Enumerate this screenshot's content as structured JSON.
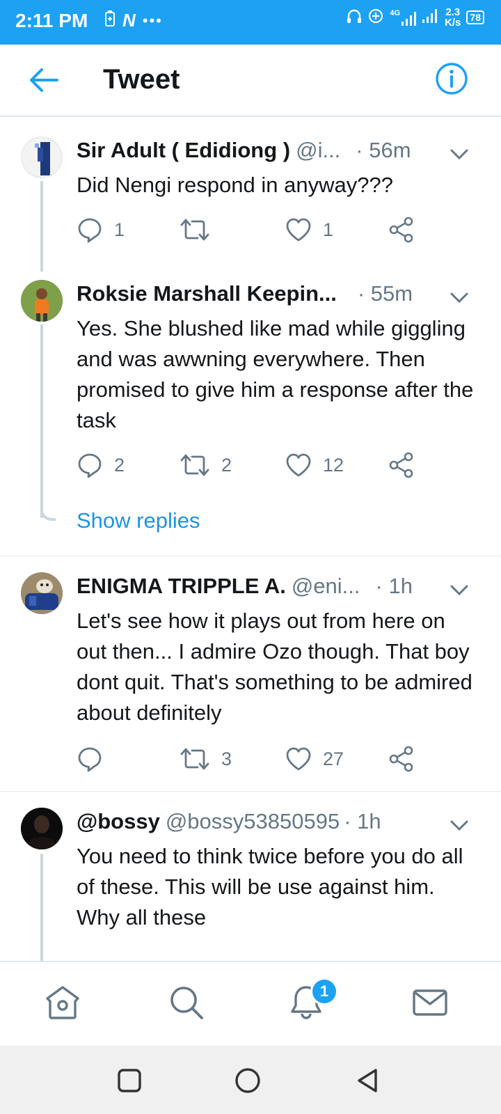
{
  "status_bar": {
    "time": "2:11 PM",
    "left_glyph": "N",
    "more_dots": "•••",
    "network_label": "4G",
    "speed_value": "2.3",
    "speed_unit": "K/s",
    "battery": "78",
    "bg_color": "#1da1f2"
  },
  "header": {
    "title": "Tweet",
    "back_icon": "arrow-left-icon",
    "info_icon": "info-icon"
  },
  "tweets": [
    {
      "name": "Sir Adult ( Edidiong )",
      "handle": "@i...",
      "time": "· 56m",
      "text": "Did Nengi respond in anyway???",
      "replies": "1",
      "retweets": "",
      "likes": "1"
    },
    {
      "name": "Roksie Marshall Keepin...",
      "handle": "",
      "time": "· 55m",
      "text": "Yes. She blushed like mad while giggling and was awwning everywhere. Then promised to give him a response after the task",
      "replies": "2",
      "retweets": "2",
      "likes": "12"
    },
    {
      "name": "ENIGMA TRIPPLE A.",
      "handle": "@eni...",
      "time": "· 1h",
      "text": "Let's see how it plays out from here on out then... I admire Ozo though. That boy dont quit. That's something to be admired about definitely",
      "replies": "",
      "retweets": "3",
      "likes": "27"
    },
    {
      "name": "@bossy",
      "handle": "@bossy53850595",
      "time": "· 1h",
      "text": "You need to think twice before you do all of these. This will be use against him. Why all these",
      "replies": "",
      "retweets": "",
      "likes": ""
    }
  ],
  "show_replies_label": "Show replies",
  "bottom_nav": {
    "notification_count": "1",
    "items": [
      "home-icon",
      "search-icon",
      "notifications-icon",
      "messages-icon"
    ]
  },
  "colors": {
    "accent": "#1da1f2",
    "link": "#1b95e0",
    "muted": "#657786"
  }
}
